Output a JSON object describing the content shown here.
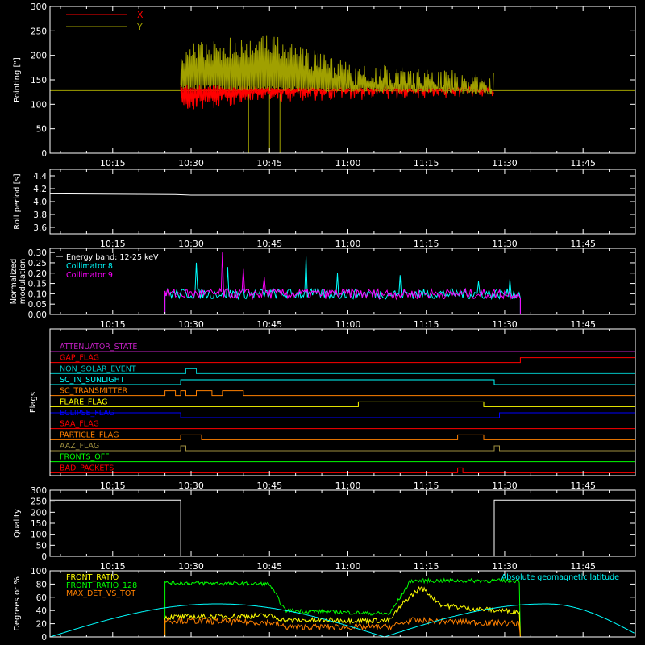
{
  "colors": {
    "background": "#000000",
    "axes": "#ffffff",
    "red": "#ff0000",
    "olive": "#a0a000",
    "white": "#ffffff",
    "cyan": "#00ffff",
    "magenta": "#ff00ff",
    "orange": "#ff8000",
    "yellow": "#ffff00",
    "green": "#00ff00",
    "blue": "#0000ff",
    "khaki": "#a09040",
    "violet": "#c020c0",
    "teal": "#00c0c0"
  },
  "time_axis": {
    "range": [
      "10:03",
      "11:55"
    ],
    "ticks": [
      "10:15",
      "10:30",
      "10:45",
      "11:00",
      "11:15",
      "11:30",
      "11:45"
    ]
  },
  "chart_data": [
    {
      "id": "pointing",
      "type": "line",
      "ylabel": "Pointing [\"]",
      "ylim": [
        0,
        300
      ],
      "yticks": [
        "0",
        "50",
        "100",
        "150",
        "200",
        "250",
        "300"
      ],
      "legend": {
        "placement": "top-left",
        "entries": [
          {
            "name": "X",
            "color": "#ff0000"
          },
          {
            "name": "Y",
            "color": "#a0a000"
          }
        ]
      },
      "series": [
        {
          "name": "X",
          "baseline": 128,
          "active": [
            "10:28",
            "11:28"
          ],
          "band_low": [
            [
              "10:28",
              85
            ],
            [
              "10:45",
              105
            ],
            [
              "11:28",
              115
            ]
          ],
          "band_high": [
            [
              "10:28",
              140
            ],
            [
              "11:28",
              132
            ]
          ]
        },
        {
          "name": "Y",
          "baseline": 128,
          "active": [
            "10:28",
            "11:28"
          ],
          "band_low": [
            [
              "10:28",
              130
            ],
            [
              "11:28",
              120
            ]
          ],
          "band_high": [
            [
              "10:28",
              225
            ],
            [
              "10:45",
              245
            ],
            [
              "11:00",
              185
            ],
            [
              "11:28",
              165
            ]
          ],
          "dips_to_zero": [
            "10:41",
            "10:45",
            "10:47"
          ]
        }
      ]
    },
    {
      "id": "roll",
      "type": "line",
      "ylabel": "Roll period [s]",
      "ylim": [
        3.5,
        4.5
      ],
      "yticks": [
        "3.6",
        "3.8",
        "4.0",
        "4.2",
        "4.4"
      ],
      "series": [
        {
          "name": "",
          "points": [
            [
              "10:03",
              4.12
            ],
            [
              "10:27",
              4.11
            ],
            [
              "10:30",
              4.1
            ],
            [
              "11:55",
              4.1
            ]
          ]
        }
      ]
    },
    {
      "id": "modulation",
      "type": "line",
      "ylabel": "Normalized modulation",
      "ylim": [
        0,
        0.32
      ],
      "yticks": [
        "0.00",
        "0.05",
        "0.10",
        "0.15",
        "0.20",
        "0.25",
        "0.30"
      ],
      "legend": {
        "placement": "top-left",
        "entries": [
          {
            "name": "Energy band: 12-25 keV",
            "color": "#ffffff"
          },
          {
            "name": "Collimator 8",
            "color": "#00ffff"
          },
          {
            "name": "Collimator 9",
            "color": "#ff00ff"
          }
        ]
      },
      "series": [
        {
          "name": "Collimator 8",
          "active": [
            "10:25",
            "11:33"
          ],
          "level": 0.1,
          "spikes": [
            [
              "10:31",
              0.25
            ],
            [
              "10:37",
              0.23
            ],
            [
              "10:52",
              0.28
            ],
            [
              "10:58",
              0.2
            ],
            [
              "11:10",
              0.19
            ],
            [
              "11:25",
              0.16
            ],
            [
              "11:31",
              0.17
            ]
          ]
        },
        {
          "name": "Collimator 9",
          "active": [
            "10:25",
            "11:33"
          ],
          "level": 0.1,
          "spikes": [
            [
              "10:36",
              0.3
            ],
            [
              "10:40",
              0.22
            ],
            [
              "10:44",
              0.18
            ]
          ]
        }
      ]
    },
    {
      "id": "flags",
      "type": "line",
      "ylabel": "Flags",
      "series": [
        {
          "name": "ATTENUATOR_STATE",
          "color": "#c020c0",
          "steps": []
        },
        {
          "name": "GAP_FLAG",
          "color": "#ff0000",
          "steps": [
            [
              "11:33",
              1
            ]
          ]
        },
        {
          "name": "NON_SOLAR_EVENT",
          "color": "#00c0c0",
          "steps": [
            [
              "10:29",
              1
            ],
            [
              "10:31",
              0
            ]
          ]
        },
        {
          "name": "SC_IN_SUNLIGHT",
          "color": "#00ffff",
          "steps": [
            [
              "10:28",
              1
            ],
            [
              "11:28",
              0
            ]
          ]
        },
        {
          "name": "SC_TRANSMITTER",
          "color": "#ff8000",
          "steps": [
            [
              "10:25",
              1
            ],
            [
              "10:27",
              0
            ],
            [
              "10:28",
              1
            ],
            [
              "10:29",
              0
            ],
            [
              "10:31",
              1
            ],
            [
              "10:34",
              0
            ],
            [
              "10:36",
              1
            ],
            [
              "10:40",
              0
            ]
          ]
        },
        {
          "name": "FLARE_FLAG",
          "color": "#ffff00",
          "steps": [
            [
              "11:02",
              1
            ],
            [
              "11:26",
              0
            ]
          ]
        },
        {
          "name": "ECLIPSE_FLAG",
          "color": "#0000ff",
          "steps": [
            [
              "10:03",
              1
            ],
            [
              "10:28",
              0
            ],
            [
              "11:29",
              1
            ]
          ]
        },
        {
          "name": "SAA_FLAG",
          "color": "#ff0000",
          "steps": []
        },
        {
          "name": "PARTICLE_FLAG",
          "color": "#ff8000",
          "steps": [
            [
              "10:28",
              1
            ],
            [
              "10:32",
              0
            ],
            [
              "11:21",
              1
            ],
            [
              "11:26",
              0
            ]
          ]
        },
        {
          "name": "AAZ_FLAG",
          "color": "#a09040",
          "steps": [
            [
              "10:28",
              1
            ],
            [
              "10:29",
              0
            ],
            [
              "11:28",
              1
            ],
            [
              "11:29",
              0
            ]
          ]
        },
        {
          "name": "FRONTS_OFF",
          "color": "#00ff00",
          "steps": []
        },
        {
          "name": "BAD_PACKETS",
          "color": "#ff0000",
          "steps": [
            [
              "11:21",
              1
            ],
            [
              "11:22",
              0
            ]
          ]
        }
      ]
    },
    {
      "id": "quality",
      "type": "line",
      "ylabel": "Quality",
      "ylim": [
        0,
        300
      ],
      "yticks": [
        "0",
        "50",
        "100",
        "150",
        "200",
        "250",
        "300"
      ],
      "series": [
        {
          "name": "",
          "points": [
            [
              "10:03",
              255
            ],
            [
              "10:28",
              255
            ],
            [
              "10:28",
              0
            ],
            [
              "11:28",
              0
            ],
            [
              "11:28",
              255
            ],
            [
              "11:55",
              255
            ]
          ]
        }
      ]
    },
    {
      "id": "ratios",
      "type": "line",
      "ylabel": "Degrees or %",
      "ylim": [
        0,
        100
      ],
      "yticks": [
        "0",
        "20",
        "40",
        "60",
        "80",
        "100"
      ],
      "legend": {
        "placement": "top-left",
        "entries": [
          {
            "name": "FRONT_RATIO",
            "color": "#ffff00"
          },
          {
            "name": "FRONT_RATIO_128",
            "color": "#00ff00"
          },
          {
            "name": "MAX_DET_VS_TOT",
            "color": "#ff8000"
          },
          {
            "name": "Absolute geomagnetic latitude",
            "color": "#00ffff"
          }
        ]
      },
      "series": [
        {
          "name": "FRONT_RATIO_128",
          "points": [
            [
              "10:25",
              82
            ],
            [
              "10:45",
              80
            ],
            [
              "10:48",
              40
            ],
            [
              "11:08",
              35
            ],
            [
              "11:12",
              85
            ],
            [
              "11:33",
              85
            ]
          ]
        },
        {
          "name": "FRONT_RATIO",
          "points": [
            [
              "10:25",
              30
            ],
            [
              "10:45",
              32
            ],
            [
              "10:48",
              25
            ],
            [
              "11:08",
              25
            ],
            [
              "11:11",
              55
            ],
            [
              "11:14",
              75
            ],
            [
              "11:18",
              48
            ],
            [
              "11:25",
              42
            ],
            [
              "11:33",
              38
            ]
          ]
        },
        {
          "name": "MAX_DET_VS_TOT",
          "points": [
            [
              "10:25",
              25
            ],
            [
              "10:45",
              22
            ],
            [
              "10:48",
              15
            ],
            [
              "11:08",
              15
            ],
            [
              "11:12",
              25
            ],
            [
              "11:33",
              20
            ]
          ]
        },
        {
          "name": "Absolute geomagnetic latitude",
          "points": [
            [
              "10:03",
              0
            ],
            [
              "10:35",
              50
            ],
            [
              "11:07",
              0
            ],
            [
              "11:38",
              50
            ],
            [
              "11:55",
              5
            ]
          ]
        }
      ]
    }
  ]
}
